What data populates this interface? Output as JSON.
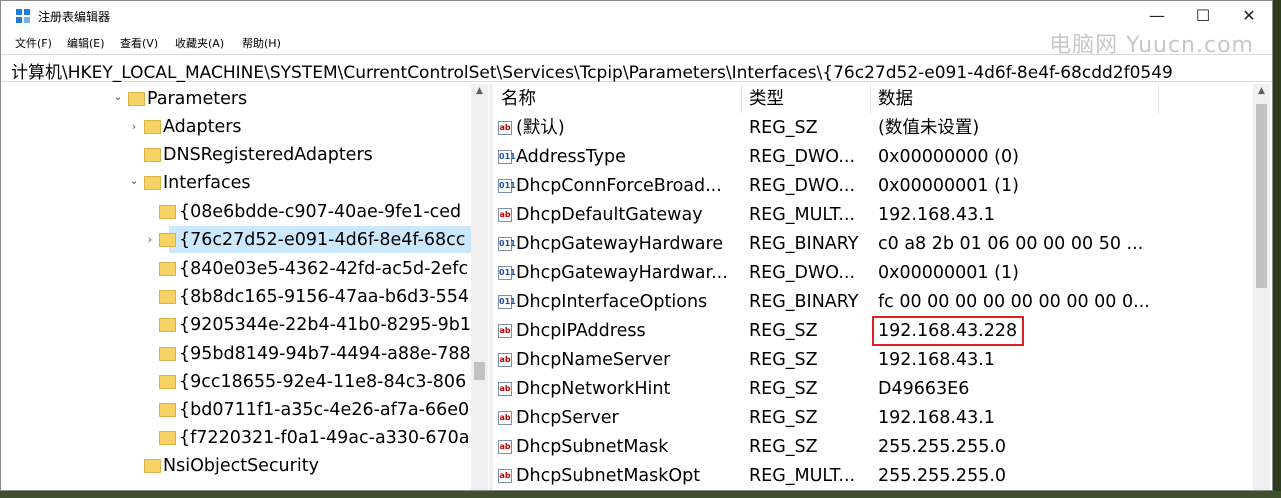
{
  "window": {
    "title": "注册表编辑器",
    "min_symbol": "—",
    "max_symbol": "☐",
    "close_symbol": "✕"
  },
  "menu": [
    "文件(F)",
    "编辑(E)",
    "查看(V)",
    "收藏夹(A)",
    "帮助(H)"
  ],
  "watermark": "电脑网 Yuucn.com",
  "address": "计算机\\HKEY_LOCAL_MACHINE\\SYSTEM\\CurrentControlSet\\Services\\Tcpip\\Parameters\\Interfaces\\{76c27d52-e091-4d6f-8e4f-68cdd2f0549",
  "tree": [
    {
      "label": "Parameters",
      "chevron": "⌄"
    },
    {
      "label": "Adapters",
      "chevron": "›"
    },
    {
      "label": "DNSRegisteredAdapters",
      "chevron": ""
    },
    {
      "label": "Interfaces",
      "chevron": "⌄"
    },
    {
      "label": "{08e6bdde-c907-40ae-9fe1-ced",
      "chevron": ""
    },
    {
      "label": "{76c27d52-e091-4d6f-8e4f-68cc",
      "chevron": "›"
    },
    {
      "label": "{840e03e5-4362-42fd-ac5d-2efc",
      "chevron": ""
    },
    {
      "label": "{8b8dc165-9156-47aa-b6d3-554",
      "chevron": ""
    },
    {
      "label": "{9205344e-22b4-41b0-8295-9b1",
      "chevron": ""
    },
    {
      "label": "{95bd8149-94b7-4494-a88e-788",
      "chevron": ""
    },
    {
      "label": "{9cc18655-92e4-11e8-84c3-806",
      "chevron": ""
    },
    {
      "label": "{bd0711f1-a35c-4e26-af7a-66e0",
      "chevron": ""
    },
    {
      "label": "{f7220321-f0a1-49ac-a330-670a",
      "chevron": ""
    },
    {
      "label": "NsiObjectSecurity",
      "chevron": ""
    }
  ],
  "columns": {
    "name": "名称",
    "type": "类型",
    "data": "数据"
  },
  "values": [
    {
      "icon": "ab",
      "name": "(默认)",
      "type": "REG_SZ",
      "data": "(数值未设置)"
    },
    {
      "icon": "bin",
      "name": "AddressType",
      "type": "REG_DWO...",
      "data": "0x00000000 (0)"
    },
    {
      "icon": "bin",
      "name": "DhcpConnForceBroad...",
      "type": "REG_DWO...",
      "data": "0x00000001 (1)"
    },
    {
      "icon": "ab",
      "name": "DhcpDefaultGateway",
      "type": "REG_MULT...",
      "data": "192.168.43.1"
    },
    {
      "icon": "bin",
      "name": "DhcpGatewayHardware",
      "type": "REG_BINARY",
      "data": "c0 a8 2b 01 06 00 00 00 50 ..."
    },
    {
      "icon": "bin",
      "name": "DhcpGatewayHardwar...",
      "type": "REG_DWO...",
      "data": "0x00000001 (1)"
    },
    {
      "icon": "bin",
      "name": "DhcpInterfaceOptions",
      "type": "REG_BINARY",
      "data": "fc 00 00 00 00 00 00 00 00 0..."
    },
    {
      "icon": "ab",
      "name": "DhcpIPAddress",
      "type": "REG_SZ",
      "data": "192.168.43.228"
    },
    {
      "icon": "ab",
      "name": "DhcpNameServer",
      "type": "REG_SZ",
      "data": "192.168.43.1"
    },
    {
      "icon": "ab",
      "name": "DhcpNetworkHint",
      "type": "REG_SZ",
      "data": "D49663E6"
    },
    {
      "icon": "ab",
      "name": "DhcpServer",
      "type": "REG_SZ",
      "data": "192.168.43.1"
    },
    {
      "icon": "ab",
      "name": "DhcpSubnetMask",
      "type": "REG_SZ",
      "data": "255.255.255.0"
    },
    {
      "icon": "ab",
      "name": "DhcpSubnetMaskOpt",
      "type": "REG_MULT...",
      "data": "255.255.255.0"
    }
  ],
  "icon_text": {
    "ab": "ab",
    "bin": "011"
  },
  "highlight_color": "#e02020",
  "selection_color": "#cce8ff"
}
